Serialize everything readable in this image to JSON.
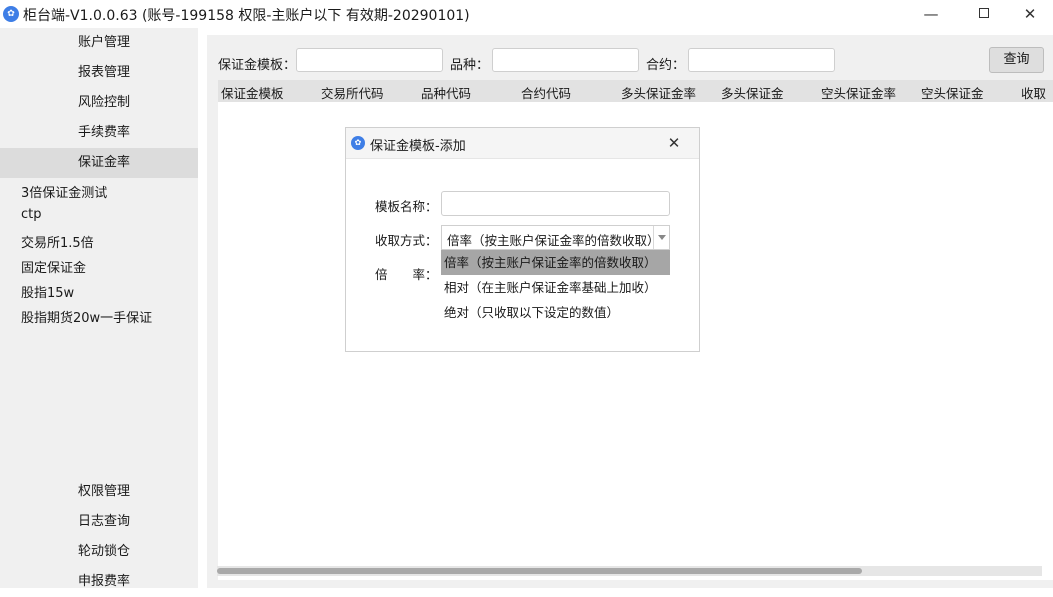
{
  "window": {
    "title": "柜台端-V1.0.0.63 (账号-199158 权限-主账户以下 有效期-20290101)",
    "app_icon": "app-logo-icon",
    "controls": {
      "minimize": "—",
      "close": "✕"
    }
  },
  "sidebar": {
    "top_items": [
      {
        "label": "账户管理"
      },
      {
        "label": "报表管理"
      },
      {
        "label": "风险控制"
      },
      {
        "label": "手续费率"
      },
      {
        "label": "保证金率",
        "active": true
      }
    ],
    "templates": [
      {
        "label": "3倍保证金测试"
      },
      {
        "label": "ctp"
      },
      {
        "label": "交易所1.5倍"
      },
      {
        "label": "固定保证金"
      },
      {
        "label": "股指15w"
      },
      {
        "label": "股指期货20w一手保证"
      }
    ],
    "bottom_items": [
      {
        "label": "权限管理"
      },
      {
        "label": "日志查询"
      },
      {
        "label": "轮动锁仓"
      },
      {
        "label": "申报费率"
      }
    ]
  },
  "filters": {
    "template_label": "保证金模板：",
    "template_value": "",
    "variety_label": "品种：",
    "variety_value": "",
    "contract_label": "合约：",
    "contract_value": "",
    "query_button": "查询"
  },
  "table": {
    "columns": [
      "保证金模板",
      "交易所代码",
      "品种代码",
      "合约代码",
      "多头保证金率",
      "多头保证金",
      "空头保证金率",
      "空头保证金",
      "收取"
    ],
    "rows": []
  },
  "dialog": {
    "title": "保证金模板-添加",
    "close": "✕",
    "name_label": "模板名称：",
    "name_value": "",
    "method_label": "收取方式：",
    "method_value": "倍率（按主账户保证金率的倍数收取）",
    "rate_label": "倍　　率：",
    "options": [
      {
        "label": "倍率（按主账户保证金率的倍数收取）",
        "selected": true
      },
      {
        "label": "相对（在主账户保证金率基础上加收）"
      },
      {
        "label": "绝对（只收取以下设定的数值）"
      }
    ]
  }
}
